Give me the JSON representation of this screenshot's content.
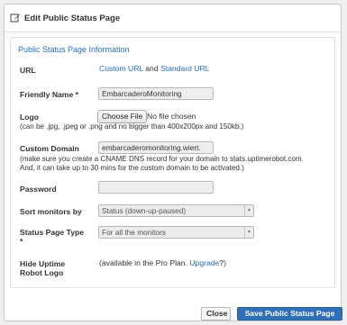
{
  "header": {
    "title": "Edit Public Status Page",
    "icon": "edit-icon"
  },
  "section": {
    "title": "Public Status Page Information"
  },
  "url": {
    "label": "URL",
    "custom_link": "Custom URL",
    "and": "and",
    "standard_link": "Standard URL"
  },
  "friendly_name": {
    "label": "Friendly Name *",
    "value": "EmbarcaderoMonitoring"
  },
  "logo": {
    "label": "Logo",
    "button": "Choose File",
    "status": "No file chosen",
    "note": "(can be .jpg, .jpeg or .png and no bigger than 400x200px and 150kb.)"
  },
  "custom_domain": {
    "label": "Custom Domain",
    "value": "embarcaderomonitoring.wiert.",
    "note_line1": "(make sure you create a CNAME DNS record for your domain to stats.uptimerobot.com.",
    "note_line2": "And, it can take up to 30 mins for the custom domain to be activated.)"
  },
  "password": {
    "label": "Password",
    "value": ""
  },
  "sort": {
    "label": "Sort monitors by",
    "selected": "Status (down-up-paused)"
  },
  "type": {
    "label": "Status Page Type",
    "required_mark": "*",
    "selected": "For all the monitors"
  },
  "hide_logo": {
    "label_line1": "Hide Uptime",
    "label_line2": "Robot Logo",
    "note_prefix": "(available in the Pro Plan.",
    "upgrade_link": "Upgrade",
    "note_suffix": "?)"
  },
  "footer": {
    "close": "Close",
    "save": "Save Public Status Page"
  },
  "colors": {
    "link": "#2a6ebb",
    "primary": "#2f6fb7"
  }
}
